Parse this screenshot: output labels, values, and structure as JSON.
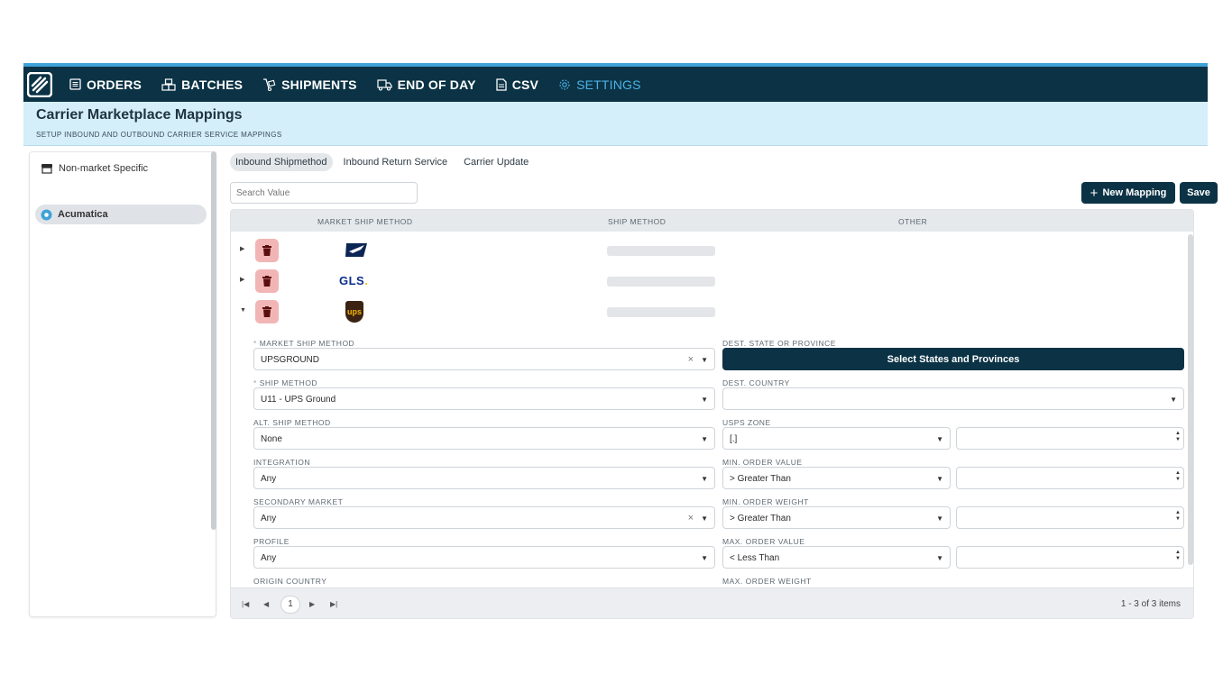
{
  "nav": {
    "items": [
      {
        "label": "ORDERS",
        "icon": "list-icon"
      },
      {
        "label": "BATCHES",
        "icon": "boxes-icon"
      },
      {
        "label": "SHIPMENTS",
        "icon": "dolly-icon"
      },
      {
        "label": "END OF DAY",
        "icon": "truck-icon"
      },
      {
        "label": "CSV",
        "icon": "file-icon"
      },
      {
        "label": "SETTINGS",
        "icon": "gear-icon"
      }
    ],
    "active": "SETTINGS"
  },
  "header": {
    "title": "Carrier Marketplace Mappings",
    "subtitle": "SETUP INBOUND AND OUTBOUND CARRIER SERVICE MAPPINGS"
  },
  "sidebar": {
    "items": [
      {
        "label": "Non-market Specific",
        "icon": "store-icon"
      },
      {
        "label": "Acumatica",
        "icon": "acumatica-icon"
      }
    ]
  },
  "tabs": [
    "Inbound Shipmethod",
    "Inbound Return Service",
    "Carrier Update"
  ],
  "search": {
    "placeholder": "Search Value"
  },
  "buttons": {
    "new_mapping": "New Mapping",
    "save": "Save"
  },
  "grid": {
    "columns": [
      "MARKET SHIP METHOD",
      "SHIP METHOD",
      "OTHER"
    ],
    "rows": [
      {
        "carrier": "USPS",
        "logo": "usps-eagle-icon"
      },
      {
        "carrier": "GLS",
        "logo_text": "GLS",
        "logo_dot": "."
      },
      {
        "carrier": "UPS",
        "logo_text": "ups",
        "expanded": true
      }
    ]
  },
  "form": {
    "left": [
      {
        "label": "MARKET SHIP METHOD",
        "required": true,
        "value": "UPSGROUND",
        "clearable": true
      },
      {
        "label": "SHIP METHOD",
        "required": true,
        "value": "U11 - UPS Ground"
      },
      {
        "label": "ALT. SHIP METHOD",
        "value": "None"
      },
      {
        "label": "INTEGRATION",
        "value": "Any"
      },
      {
        "label": "SECONDARY MARKET",
        "value": "Any",
        "clearable": true
      },
      {
        "label": "PROFILE",
        "value": "Any"
      },
      {
        "label": "ORIGIN COUNTRY",
        "value": ""
      }
    ],
    "right": {
      "dest_state_label": "DEST. STATE OR PROVINCE",
      "dest_state_button": "Select States and Provinces",
      "dest_country_label": "DEST. COUNTRY",
      "dest_country_value": "",
      "usps_zone_label": "USPS ZONE",
      "usps_zone_value": "[.]",
      "min_value_label": "MIN. ORDER VALUE",
      "min_value_op": "> Greater Than",
      "min_weight_label": "MIN. ORDER WEIGHT",
      "min_weight_op": "> Greater Than",
      "max_value_label": "MAX. ORDER VALUE",
      "max_value_op": "< Less Than",
      "max_weight_label": "MAX. ORDER WEIGHT"
    },
    "required_mark": "*"
  },
  "pager": {
    "current_page": "1",
    "summary": "1 - 3 of 3 items"
  },
  "colors": {
    "navy": "#0b3345",
    "accent": "#4cb3e6",
    "header_bg": "#d4eefa",
    "delete_bg": "#f2b5b5"
  }
}
